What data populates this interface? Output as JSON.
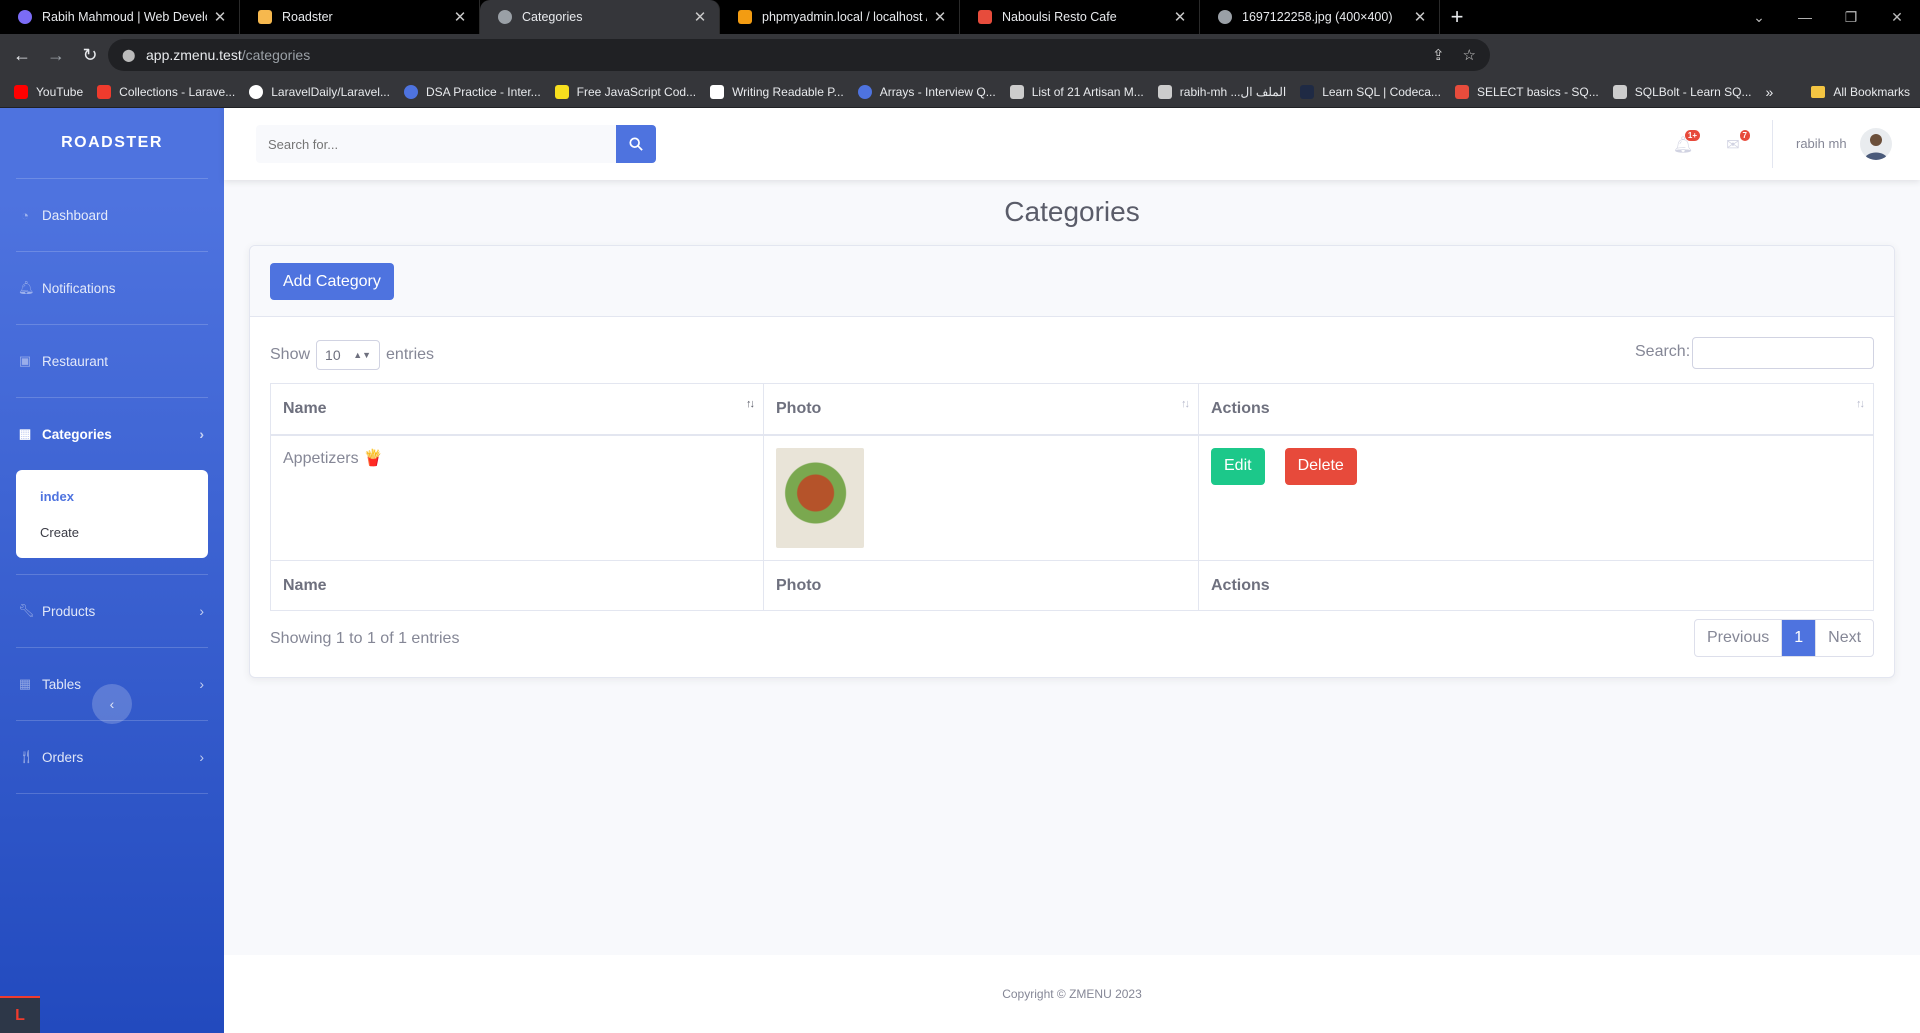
{
  "browser": {
    "tabs": [
      {
        "title": "Rabih Mahmoud | Web Develop",
        "color": "#7b6cf6"
      },
      {
        "title": "Roadster",
        "color": "#f6b84e"
      },
      {
        "title": "Categories",
        "color": "#9aa0a6"
      },
      {
        "title": "phpmyadmin.local / localhost / r",
        "color": "#f39c12"
      },
      {
        "title": "Naboulsi Resto Cafe",
        "color": "#e74c3c"
      },
      {
        "title": "1697122258.jpg (400×400)",
        "color": "#9aa0a6"
      }
    ],
    "active_tab": 2,
    "url_host": "app.zmenu.test",
    "url_path": "/categories",
    "bookmarks": [
      {
        "label": "YouTube",
        "color": "#ff0000"
      },
      {
        "label": "Collections - Larave...",
        "color": "#ef3b2d"
      },
      {
        "label": "LaravelDaily/Laravel...",
        "color": "#ffffff"
      },
      {
        "label": "DSA Practice - Inter...",
        "color": "#4e73df"
      },
      {
        "label": "Free JavaScript Cod...",
        "color": "#f7df1e"
      },
      {
        "label": "Writing Readable P...",
        "color": "#ffffff"
      },
      {
        "label": "Arrays - Interview Q...",
        "color": "#4e73df"
      },
      {
        "label": "List of 21 Artisan M...",
        "color": "#cccccc"
      },
      {
        "label": "rabih-mh ...الملف ال",
        "color": "#cccccc"
      },
      {
        "label": "Learn SQL | Codeca...",
        "color": "#1f2a44"
      },
      {
        "label": "SELECT basics - SQ...",
        "color": "#e74c3c"
      },
      {
        "label": "SQLBolt - Learn SQ...",
        "color": "#cccccc"
      }
    ],
    "all_bookmarks": "All Bookmarks"
  },
  "sidebar": {
    "brand": "ROADSTER",
    "items": [
      {
        "label": "Dashboard",
        "icon": "tachometer-icon"
      },
      {
        "label": "Notifications",
        "icon": "bell-icon"
      },
      {
        "label": "Restaurant",
        "icon": "briefcase-icon"
      },
      {
        "label": "Categories",
        "icon": "table-icon",
        "active": true
      },
      {
        "label": "Products",
        "icon": "wrench-icon"
      },
      {
        "label": "Tables",
        "icon": "table-icon"
      },
      {
        "label": "Orders",
        "icon": "utensils-icon"
      }
    ],
    "sub_items": [
      "index",
      "Create"
    ]
  },
  "topbar": {
    "search_placeholder": "Search for...",
    "alerts_count": "1+",
    "messages_count": "7",
    "user_name": "rabih mh"
  },
  "main": {
    "title": "Categories",
    "add_button": "Add Category",
    "show_label": "Show",
    "entries_value": "10",
    "entries_label": "entries",
    "search_label": "Search:",
    "columns": [
      "Name",
      "Photo",
      "Actions"
    ],
    "rows": [
      {
        "name": "Appetizers",
        "emoji": "🍟",
        "edit": "Edit",
        "delete": "Delete"
      }
    ],
    "info": "Showing 1 to 1 of 1 entries",
    "pagination": {
      "previous": "Previous",
      "current": "1",
      "next": "Next"
    }
  },
  "footer": {
    "copyright": "Copyright © ZMENU 2023"
  }
}
